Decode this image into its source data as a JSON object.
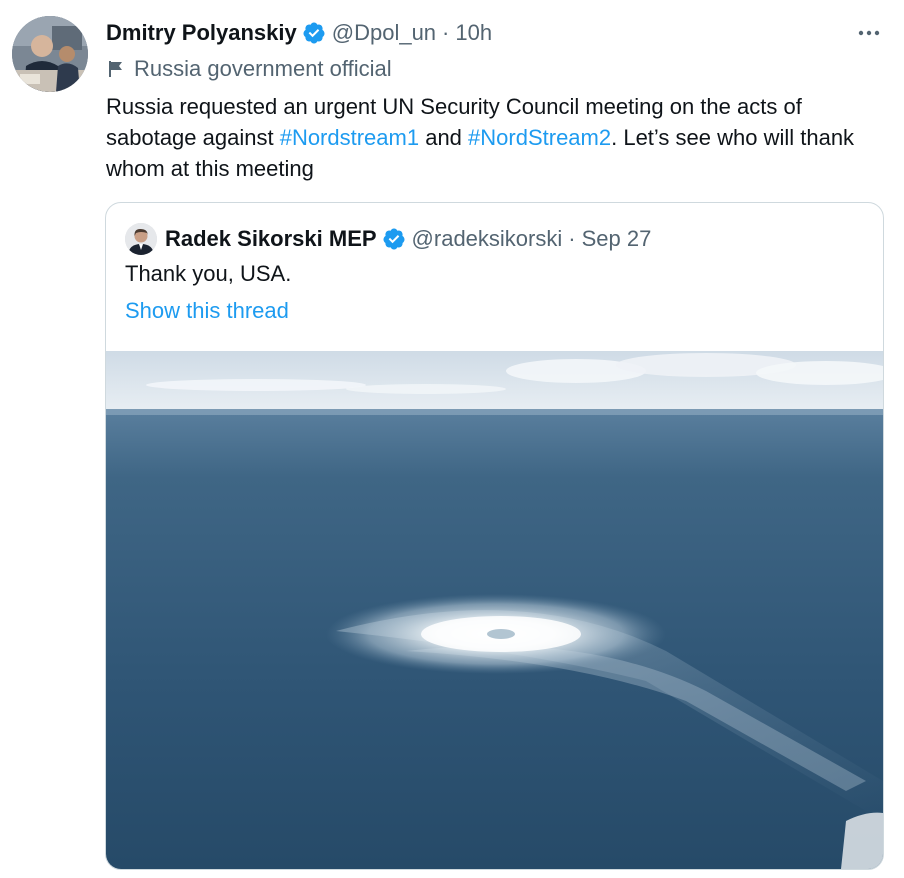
{
  "tweet": {
    "author_name": "Dmitry Polyanskiy",
    "handle": "@Dpol_un",
    "separator": "·",
    "time": "10h",
    "label": "Russia government official",
    "text_part1": "Russia requested an urgent UN Security Council meeting on the acts of sabotage against ",
    "hashtag1": "#Nordstream1",
    "text_part2": " and ",
    "hashtag2": "#NordStream2",
    "text_part3": ". Let’s see who will thank whom at this meeting"
  },
  "quoted": {
    "author_name": "Radek Sikorski MEP",
    "handle": "@radeksikorski",
    "separator": "·",
    "time": "Sep 27",
    "text": "Thank you, USA.",
    "thread_link": "Show this thread"
  },
  "icons": {
    "verified": "verified-badge-icon",
    "more": "more-options-icon",
    "label_flag": "flag-icon"
  },
  "colors": {
    "link": "#1d9bf0",
    "secondary_text": "#536471",
    "border": "#cfd9de"
  }
}
